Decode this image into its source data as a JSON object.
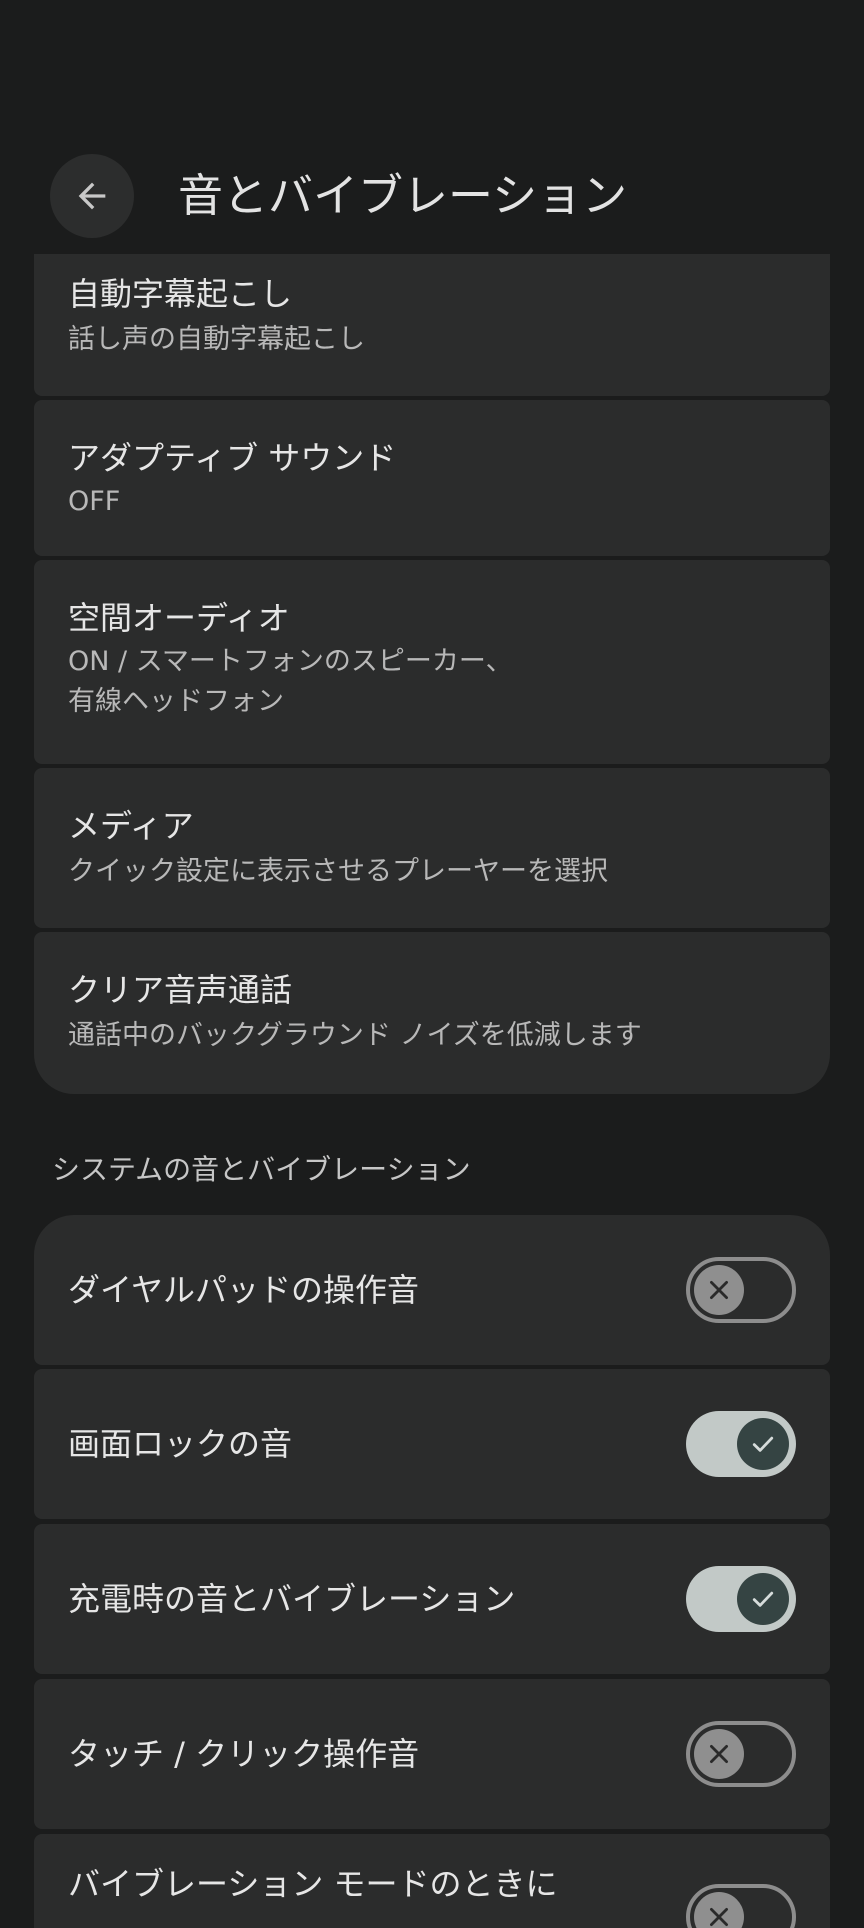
{
  "header": {
    "title": "音とバイブレーション"
  },
  "settings": [
    {
      "title": "自動字幕起こし",
      "subtitle": "話し声の自動字幕起こし"
    },
    {
      "title": "アダプティブ サウンド",
      "subtitle": "OFF"
    },
    {
      "title": "空間オーディオ",
      "subtitle": "ON / スマートフォンのスピーカー、\n有線ヘッドフォン"
    },
    {
      "title": "メディア",
      "subtitle": "クイック設定に表示させるプレーヤーを選択"
    },
    {
      "title": "クリア音声通話",
      "subtitle": "通話中のバックグラウンド ノイズを低減します"
    }
  ],
  "system_section": {
    "header": "システムの音とバイブレーション",
    "items": [
      {
        "label": "ダイヤルパッドの操作音",
        "enabled": false
      },
      {
        "label": "画面ロックの音",
        "enabled": true
      },
      {
        "label": "充電時の音とバイブレーション",
        "enabled": true
      },
      {
        "label": "タッチ / クリック操作音",
        "enabled": false
      },
      {
        "label": "バイブレーション モードのときに",
        "enabled": false
      }
    ]
  },
  "colors": {
    "background": "#1b1c1c",
    "card": "#2b2c2c",
    "toggle_on_track": "#c2c9c7",
    "toggle_on_thumb": "#354443",
    "toggle_off_border": "#8d8d8d"
  }
}
